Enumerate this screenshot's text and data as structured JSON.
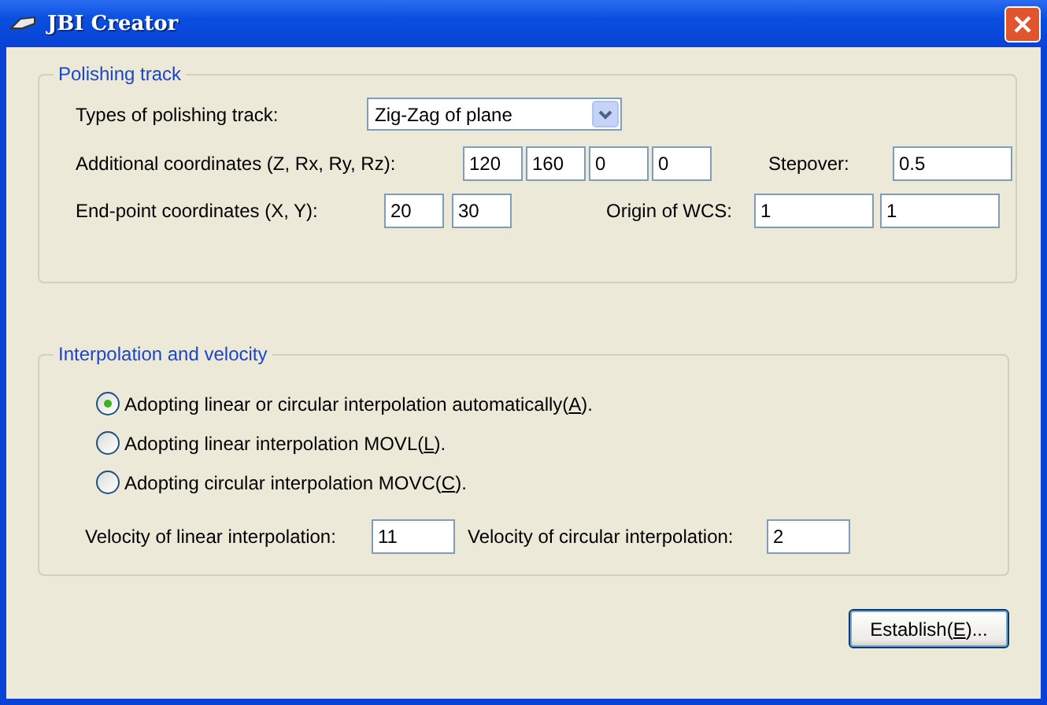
{
  "window": {
    "title": "JBI Creator"
  },
  "polishing_track": {
    "title": "Polishing track",
    "track_type": {
      "label": "Types of polishing track:",
      "value": "Zig-Zag of plane"
    },
    "additional_coordinates": {
      "label": "Additional coordinates (Z, Rx, Ry, Rz):",
      "values": [
        "120",
        "160",
        "0",
        "0"
      ]
    },
    "stepover": {
      "label": "Stepover:",
      "value": "0.5"
    },
    "end_point": {
      "label": "End-point coordinates (X, Y):",
      "values": [
        "20",
        "30"
      ]
    },
    "origin_of_wcs": {
      "label": "Origin of WCS:",
      "values": [
        "1",
        "1"
      ]
    }
  },
  "interpolation": {
    "title": "Interpolation and velocity",
    "options": [
      {
        "before": "Adopting linear or circular interpolation automatically(",
        "key": "A",
        "after": ").",
        "selected": true
      },
      {
        "before": "Adopting linear interpolation MOVL(",
        "key": "L",
        "after": ").",
        "selected": false
      },
      {
        "before": "Adopting circular interpolation MOVC(",
        "key": "C",
        "after": ").",
        "selected": false
      }
    ],
    "linear_velocity": {
      "label": "Velocity of linear interpolation:",
      "value": "11"
    },
    "circular_velocity": {
      "label": "Velocity of circular interpolation:",
      "value": "2"
    }
  },
  "button": {
    "before": "Establish(",
    "key": "E",
    "after": ")..."
  }
}
